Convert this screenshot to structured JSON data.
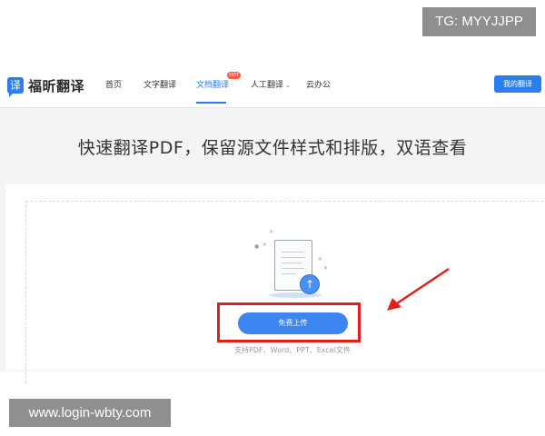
{
  "watermarks": {
    "top": "TG: MYYJJPP",
    "bottom": "www.login-wbty.com"
  },
  "nav": {
    "logo_icon": "译",
    "logo_text": "福昕翻译",
    "items": [
      {
        "label": "首页"
      },
      {
        "label": "文字翻译"
      },
      {
        "label": "文档翻译"
      },
      {
        "label": "人工翻译"
      },
      {
        "label": "云办公"
      }
    ],
    "hot_badge": "HOT",
    "dropdown_caret": "⌄",
    "login_label": "我的翻译",
    "colors": {
      "accent": "#2b7ef0"
    }
  },
  "hero": {
    "headline": "快速翻译PDF，保留源文件样式和排版，双语查看"
  },
  "upload": {
    "button_label": "免费上传",
    "support_text": "支持PDF、Word、PPT、Excel文件",
    "arrow_glyph": "↑",
    "icons": [
      "document-icon",
      "upload-arrow-icon"
    ]
  }
}
